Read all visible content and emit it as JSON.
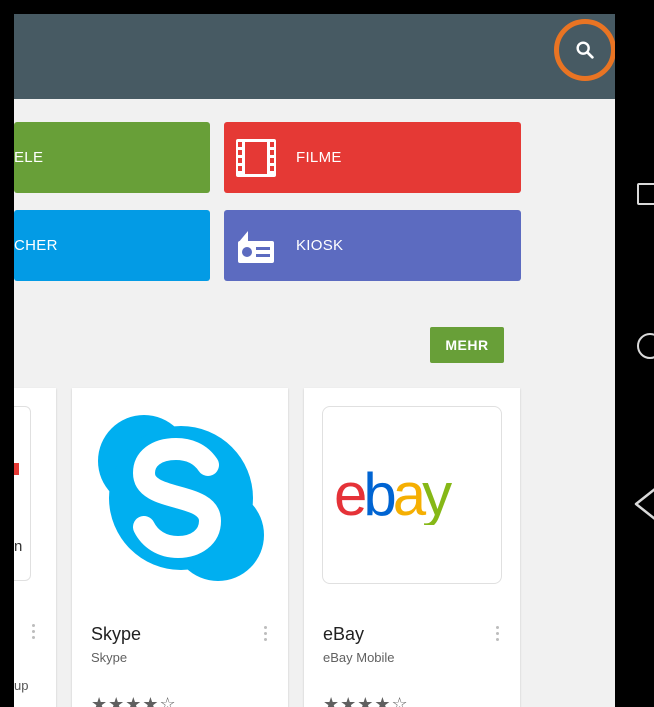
{
  "toolbar": {
    "search_icon": "search-icon"
  },
  "categories": [
    {
      "label": "ELE",
      "color": "#689f38"
    },
    {
      "label": "FILME",
      "color": "#e53935",
      "icon": "film-icon"
    },
    {
      "label": "CHER",
      "color": "#039be5"
    },
    {
      "label": "KIOSK",
      "color": "#5c6bc0",
      "icon": "newsstand-icon"
    }
  ],
  "section": {
    "more_label": "MEHR"
  },
  "apps": [
    {
      "title": "",
      "developer": "",
      "partial_text": "up",
      "partial_letter": "n"
    },
    {
      "title": "Skype",
      "developer": "Skype",
      "icon": "skype-logo-icon",
      "stars": "★★★★☆"
    },
    {
      "title": "eBay",
      "developer": "eBay Mobile",
      "icon": "ebay-logo-icon",
      "stars": "★★★★☆"
    }
  ],
  "colors": {
    "topbar": "#475a63",
    "highlight_ring": "#e97423",
    "ebay_e": "#e53238",
    "ebay_b": "#0064d2",
    "ebay_a": "#f5af02",
    "ebay_y": "#86b817"
  },
  "system_nav": [
    "recent-apps-icon",
    "home-icon",
    "back-icon"
  ]
}
